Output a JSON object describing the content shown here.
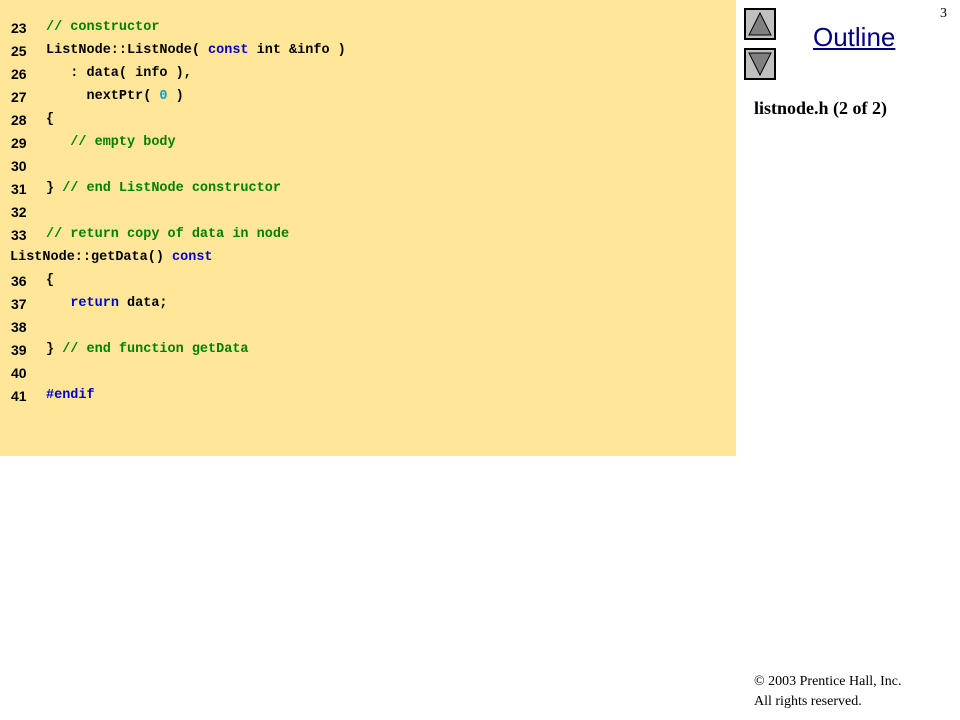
{
  "slide": {
    "page_number": "3",
    "outline_label": "Outline",
    "file_caption": "listnode.h (2 of 2)",
    "copyright_line1": "© 2003 Prentice Hall, Inc.",
    "copyright_line2": "All rights reserved."
  },
  "nav": {
    "up_icon": "triangle-up-icon",
    "down_icon": "triangle-down-icon"
  },
  "colors": {
    "code_background": "#ffe699",
    "comment": "#008000",
    "keyword": "#0000cc",
    "number": "#00a0d0",
    "link": "#000080"
  },
  "code_lines": [
    {
      "num": "23",
      "tokens": [
        {
          "t": "// constructor",
          "k": "comment"
        }
      ]
    },
    {
      "num": "25",
      "tokens": [
        {
          "t": "ListNode::ListNode( ",
          "k": "plain"
        },
        {
          "t": "const",
          "k": "keyword"
        },
        {
          "t": " int &info )",
          "k": "plain"
        }
      ]
    },
    {
      "num": "26",
      "tokens": [
        {
          "t": "   : data( info ),",
          "k": "plain"
        }
      ]
    },
    {
      "num": "27",
      "tokens": [
        {
          "t": "     nextPtr( ",
          "k": "plain"
        },
        {
          "t": "0",
          "k": "number"
        },
        {
          "t": " )",
          "k": "plain"
        }
      ]
    },
    {
      "num": "28",
      "tokens": [
        {
          "t": "{",
          "k": "plain"
        }
      ]
    },
    {
      "num": "29",
      "tokens": [
        {
          "t": "   // empty body",
          "k": "comment"
        }
      ]
    },
    {
      "num": "30",
      "tokens": []
    },
    {
      "num": "31",
      "tokens": [
        {
          "t": "} ",
          "k": "plain"
        },
        {
          "t": "// end ListNode constructor",
          "k": "comment"
        }
      ]
    },
    {
      "num": "32",
      "tokens": []
    },
    {
      "num": "33",
      "tokens": [
        {
          "t": "// return copy of data in node",
          "k": "comment"
        }
      ]
    },
    {
      "num": "",
      "tokens": [
        {
          "t": "ListNode::getData() ",
          "k": "plain"
        },
        {
          "t": "const",
          "k": "keyword"
        }
      ]
    },
    {
      "num": "36",
      "tokens": [
        {
          "t": "{",
          "k": "plain"
        }
      ]
    },
    {
      "num": "37",
      "tokens": [
        {
          "t": "   ",
          "k": "plain"
        },
        {
          "t": "return",
          "k": "keyword"
        },
        {
          "t": " data;",
          "k": "plain"
        }
      ]
    },
    {
      "num": "38",
      "tokens": []
    },
    {
      "num": "39",
      "tokens": [
        {
          "t": "} ",
          "k": "plain"
        },
        {
          "t": "// end function getData",
          "k": "comment"
        }
      ]
    },
    {
      "num": "40",
      "tokens": []
    },
    {
      "num": "41",
      "tokens": [
        {
          "t": "#endif",
          "k": "keyword"
        }
      ]
    }
  ]
}
